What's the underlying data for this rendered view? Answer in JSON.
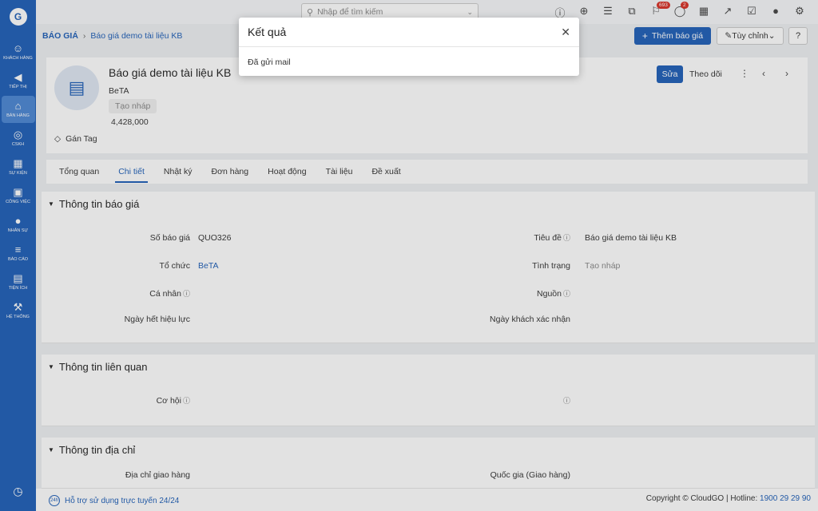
{
  "sidebar": {
    "logo": "G",
    "items": [
      {
        "label": "Khách hàng",
        "icon": "users-icon"
      },
      {
        "label": "Tiếp thị",
        "icon": "megaphone-icon"
      },
      {
        "label": "Bán hàng",
        "icon": "cart-icon"
      },
      {
        "label": "CSKH",
        "icon": "support-icon"
      },
      {
        "label": "Sự kiện",
        "icon": "calendar-icon"
      },
      {
        "label": "Công việc",
        "icon": "briefcase-icon"
      },
      {
        "label": "Nhân sự",
        "icon": "person-icon"
      },
      {
        "label": "Báo cáo",
        "icon": "report-icon"
      },
      {
        "label": "Tiện ích",
        "icon": "utilities-icon"
      },
      {
        "label": "Hệ thống",
        "icon": "wrench-icon"
      }
    ]
  },
  "search": {
    "placeholder": "Nhập để tìm kiếm"
  },
  "topbar": {
    "notifications_count": "693",
    "messages_count": "2"
  },
  "breadcrumb": {
    "module": "BÁO GIÁ",
    "page": "Báo giá demo tài liệu KB"
  },
  "actions": {
    "add_label": "Thêm báo giá",
    "customize_label": "Tùy chỉnh"
  },
  "record": {
    "title": "Báo giá demo tài liệu KB",
    "organization": "BeTA",
    "status": "Tạo nháp",
    "amount": "4,428,000",
    "tag_label": "Gán Tag",
    "edit_label": "Sửa",
    "follow_label": "Theo dõi"
  },
  "tabs": [
    "Tổng quan",
    "Chi tiết",
    "Nhật ký",
    "Đơn hàng",
    "Hoạt động",
    "Tài liệu",
    "Đề xuất"
  ],
  "sections": {
    "quote_info": {
      "title": "Thông tin báo giá",
      "fields": {
        "quote_no_label": "Số báo giá",
        "quote_no_value": "QUO326",
        "subject_label": "Tiêu đề",
        "subject_value": "Báo giá demo tài liệu KB",
        "org_label": "Tổ chức",
        "org_value": "BeTA",
        "status_label": "Tình trạng",
        "status_value": "Tạo nháp",
        "contact_label": "Cá nhân",
        "source_label": "Nguồn",
        "expiry_label": "Ngày hết hiệu lực",
        "confirm_label": "Ngày khách xác nhận"
      }
    },
    "related_info": {
      "title": "Thông tin liên quan",
      "fields": {
        "opportunity_label": "Cơ hội"
      }
    },
    "address_info": {
      "title": "Thông tin địa chỉ",
      "fields": {
        "ship_address_label": "Địa chỉ giao hàng",
        "ship_country_label": "Quốc gia (Giao hàng)"
      }
    }
  },
  "footer": {
    "support_text": "Hỗ trợ sử dụng trực tuyến 24/24",
    "support_icon_text": "24h",
    "copyright": "Copyright © CloudGO",
    "hotline_label": "Hotline:",
    "hotline_number": "1900 29 29 90"
  },
  "modal": {
    "title": "Kết quả",
    "message": "Đã gửi mail"
  },
  "colors": {
    "brand": "#1e5fb8",
    "badge": "#d93025"
  }
}
